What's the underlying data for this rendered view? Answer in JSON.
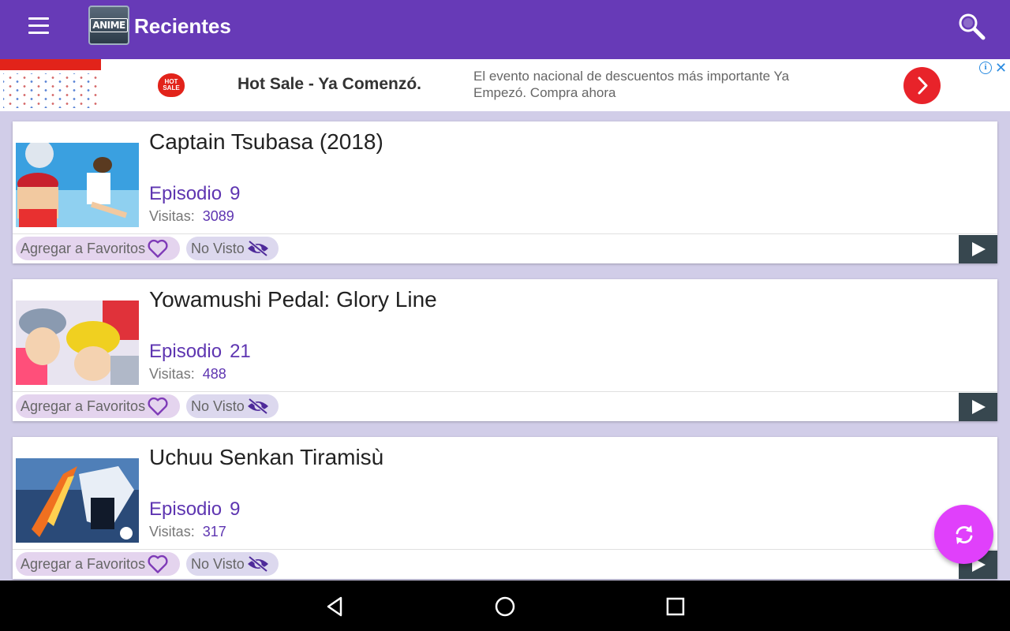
{
  "app": {
    "title": "Recientes",
    "logo_text": "ANIME",
    "accent_color": "#673ab7",
    "fab_color": "#e040fb"
  },
  "ad": {
    "headline": "Hot Sale - Ya Comenzó.",
    "description": "El evento nacional de descuentos más importante Ya Empezó. Compra ahora",
    "badge_text": "HOT SALE",
    "icons": [
      "info-icon",
      "close-icon",
      "chevron-right-icon"
    ]
  },
  "labels": {
    "episode": "Episodio",
    "visits": "Visitas:",
    "favorite": "Agregar a Favoritos",
    "not_seen": "No Visto"
  },
  "episodes": [
    {
      "title": "Captain Tsubasa (2018)",
      "episode": "9",
      "visits": "3089"
    },
    {
      "title": "Yowamushi Pedal: Glory Line",
      "episode": "21",
      "visits": "488"
    },
    {
      "title": "Uchuu Senkan Tiramisù",
      "episode": "9",
      "visits": "317"
    }
  ],
  "navigation": {
    "icons": [
      "back-icon",
      "home-icon",
      "recents-icon"
    ]
  }
}
